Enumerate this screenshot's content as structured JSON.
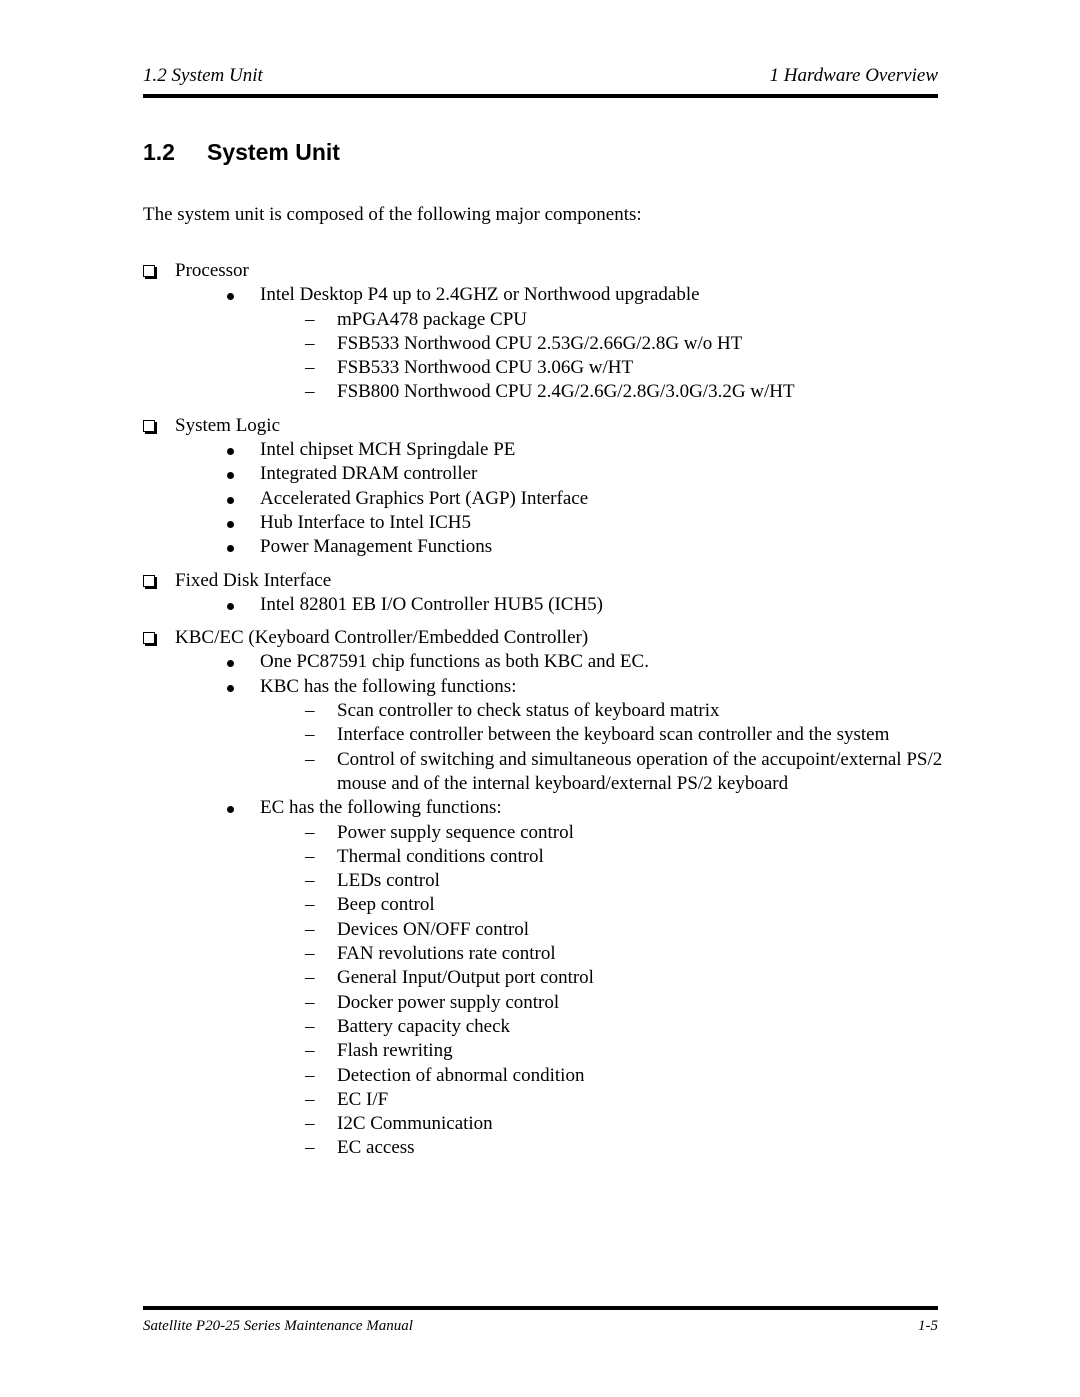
{
  "header": {
    "left": "1.2 System Unit",
    "right": "1  Hardware Overview"
  },
  "section": {
    "number": "1.2",
    "title": "System Unit"
  },
  "intro": "The system unit is composed of the following major components:",
  "groups": [
    {
      "label": "Processor",
      "items": [
        {
          "text": "Intel Desktop P4 up to 2.4GHZ or Northwood upgradable",
          "subitems": [
            "mPGA478 package CPU",
            "FSB533 Northwood CPU 2.53G/2.66G/2.8G w/o HT",
            "FSB533 Northwood CPU 3.06G w/HT",
            "FSB800 Northwood CPU 2.4G/2.6G/2.8G/3.0G/3.2G w/HT"
          ]
        }
      ]
    },
    {
      "label": "System Logic",
      "items": [
        {
          "text": "Intel chipset MCH Springdale PE"
        },
        {
          "text": "Integrated DRAM controller"
        },
        {
          "text": "Accelerated Graphics Port (AGP) Interface"
        },
        {
          "text": "Hub Interface to Intel ICH5"
        },
        {
          "text": "Power Management Functions"
        }
      ]
    },
    {
      "label": "Fixed Disk Interface",
      "items": [
        {
          "text": "Intel 82801 EB I/O Controller HUB5 (ICH5)"
        }
      ]
    },
    {
      "label": "KBC/EC (Keyboard Controller/Embedded Controller)",
      "items": [
        {
          "text": "One PC87591 chip functions as both KBC and EC."
        },
        {
          "text": "KBC has the following functions:",
          "subitems": [
            "Scan controller to check status of keyboard matrix",
            "Interface controller between the keyboard scan controller and the system",
            "Control of switching and simultaneous operation of the accupoint/external PS/2 mouse and of the internal keyboard/external PS/2 keyboard"
          ]
        },
        {
          "text": "EC has the following functions:",
          "subitems": [
            "Power supply sequence control",
            "Thermal conditions control",
            "LEDs control",
            "Beep control",
            "Devices ON/OFF control",
            "FAN revolutions rate control",
            "General Input/Output port control",
            "Docker power supply control",
            "Battery capacity check",
            "Flash rewriting",
            "Detection of abnormal condition",
            "EC I/F",
            "I2C Communication",
            "EC access"
          ]
        }
      ]
    }
  ],
  "footer": {
    "left": "Satellite P20-25 Series Maintenance Manual",
    "right": "1-5"
  }
}
